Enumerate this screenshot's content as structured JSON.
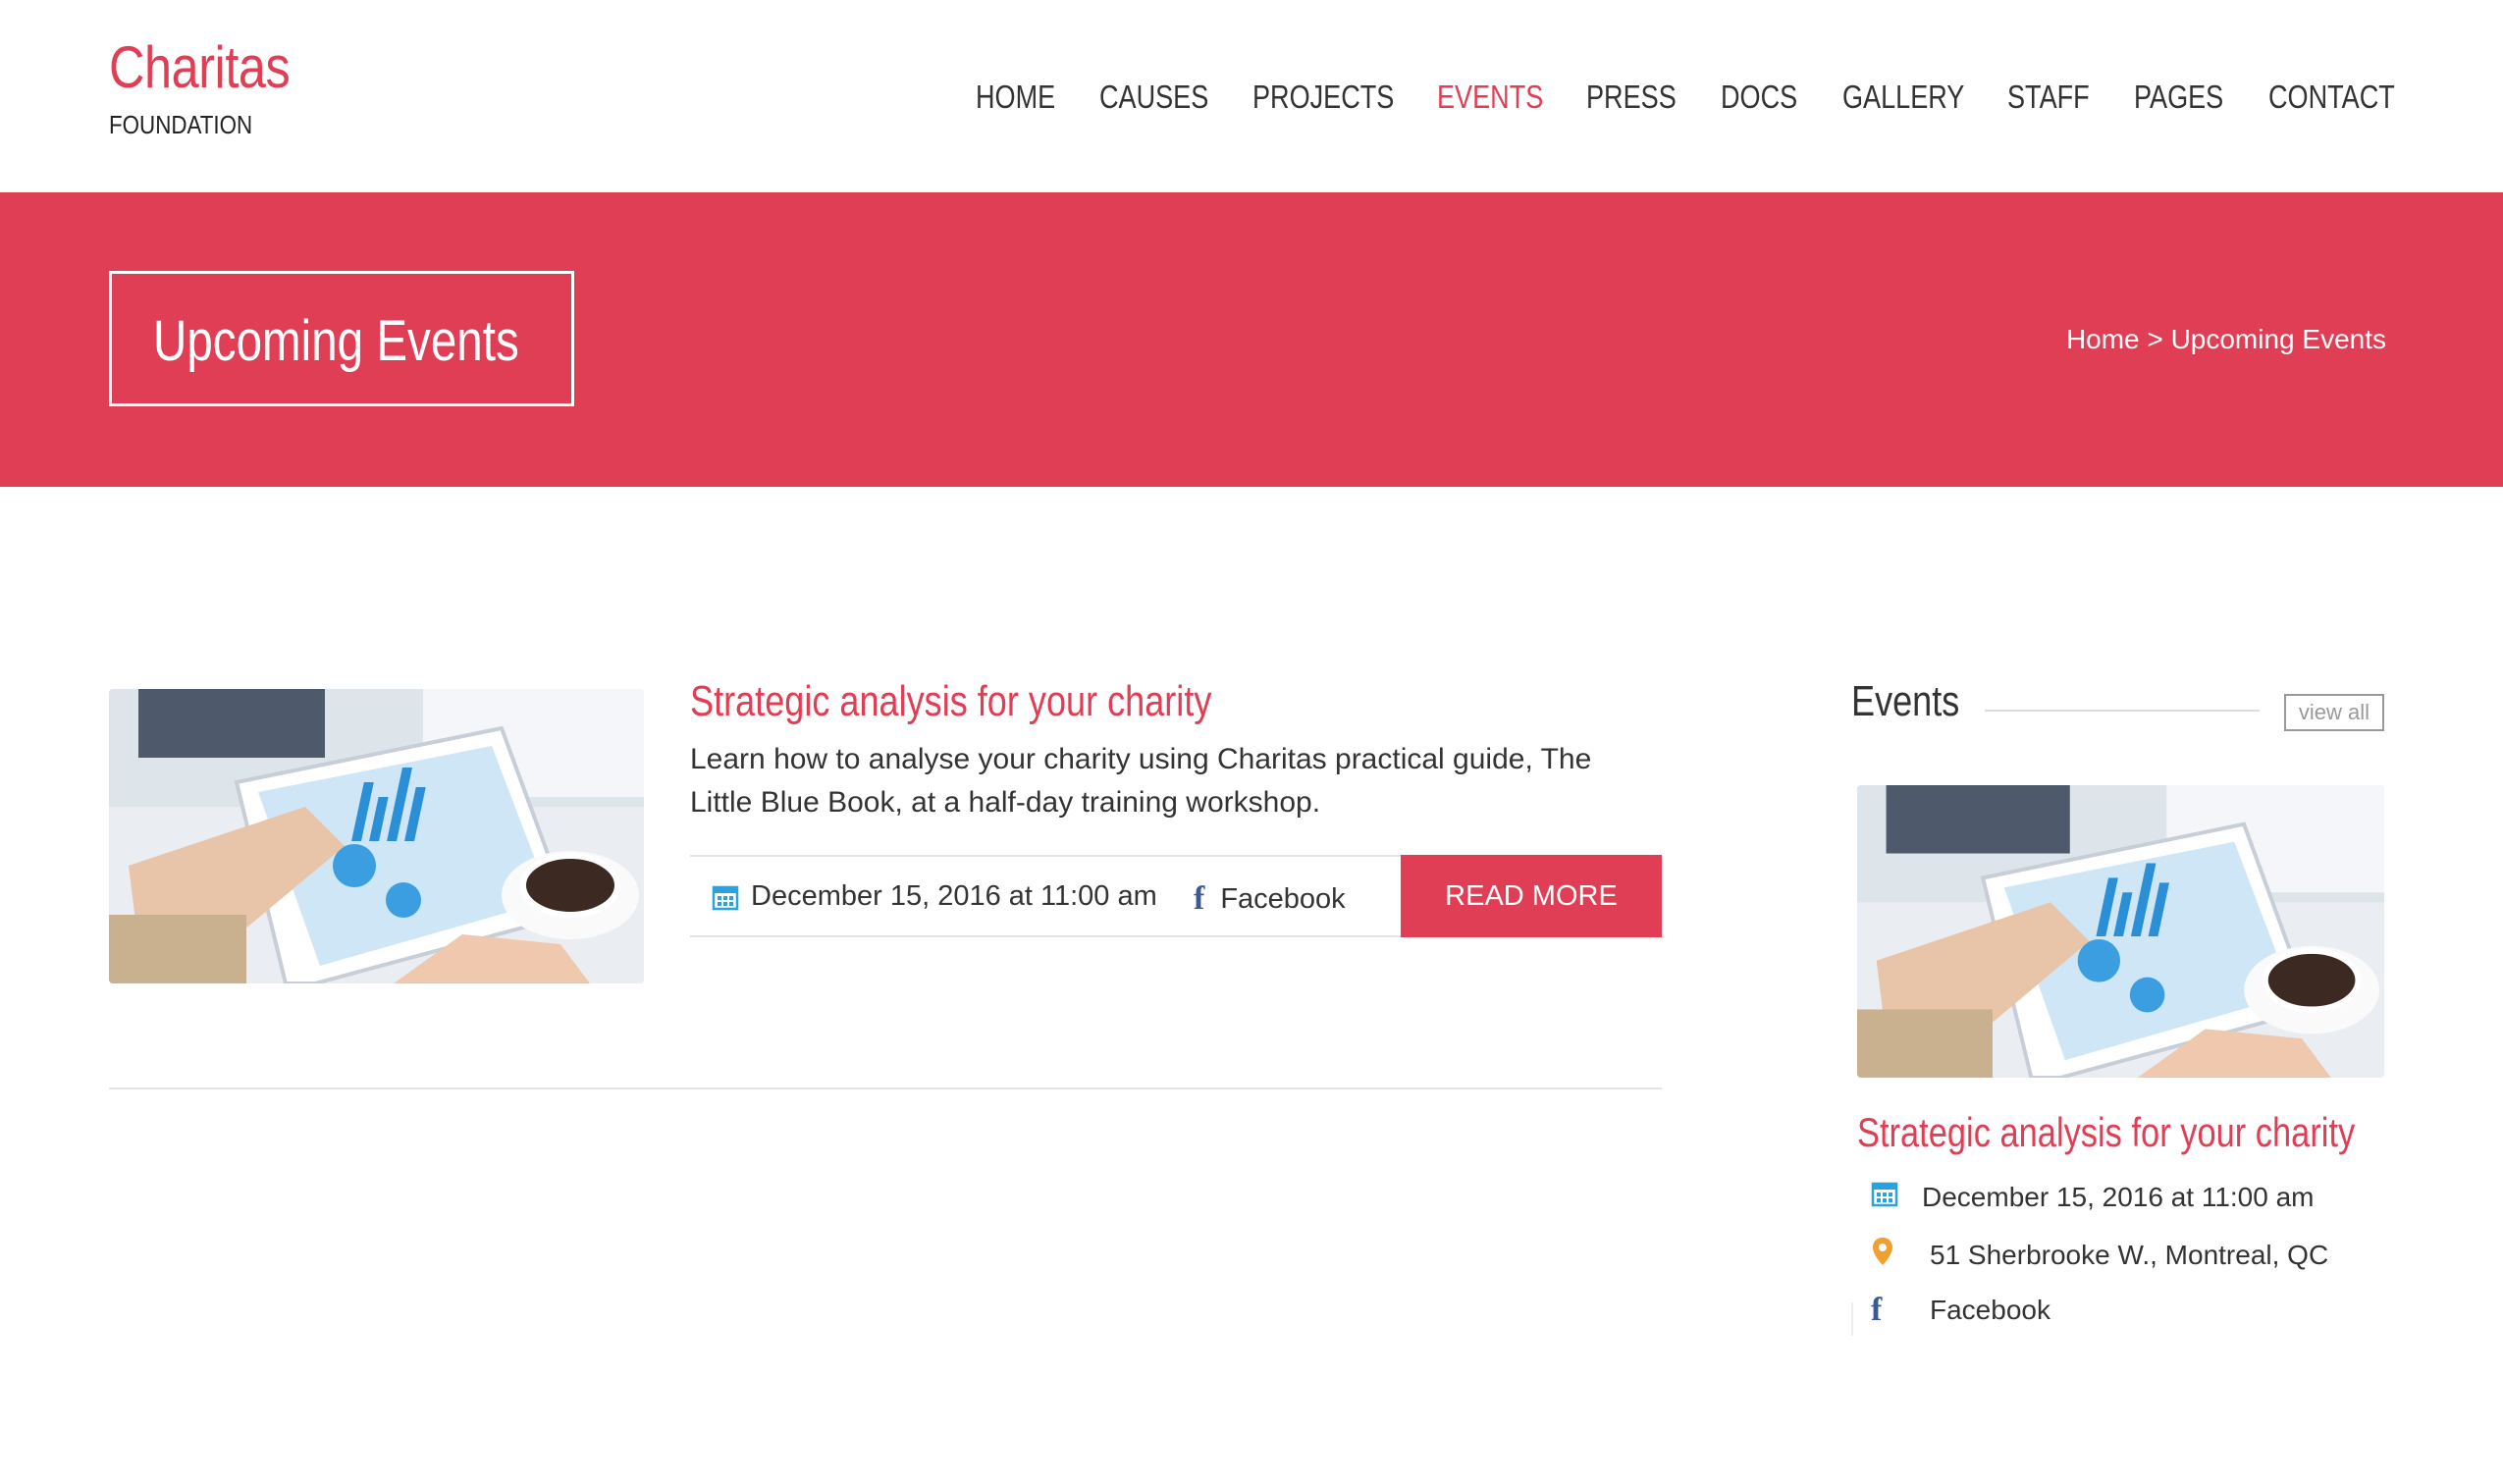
{
  "brand": {
    "name": "Charitas",
    "subtitle": "FOUNDATION"
  },
  "nav": {
    "items": [
      "HOME",
      "CAUSES",
      "PROJECTS",
      "EVENTS",
      "PRESS",
      "DOCS",
      "GALLERY",
      "STAFF",
      "PAGES",
      "CONTACT"
    ],
    "active": "EVENTS"
  },
  "banner": {
    "title": "Upcoming Events",
    "breadcrumb": {
      "home": "Home",
      "separator": ">",
      "current": "Upcoming Events"
    }
  },
  "event": {
    "title": "Strategic analysis for your charity",
    "description": "Learn how to analyse your charity using Charitas practical guide, The Little Blue Book, at a half-day training workshop.",
    "date": "December 15, 2016 at 11:00 am",
    "social": "Facebook",
    "read_more": "READ MORE"
  },
  "sidebar": {
    "heading": "Events",
    "view_all": "view all",
    "event": {
      "title": "Strategic analysis for your charity",
      "date": "December 15, 2016 at 11:00 am",
      "location": "51 Sherbrooke W., Montreal, QC",
      "social": "Facebook"
    }
  },
  "colors": {
    "accent": "#e03e54",
    "calendar_icon": "#29a3e0",
    "pin_icon": "#f0a030",
    "facebook_icon": "#3b5998"
  },
  "icons": [
    "calendar-icon",
    "facebook-icon",
    "location-pin-icon"
  ]
}
